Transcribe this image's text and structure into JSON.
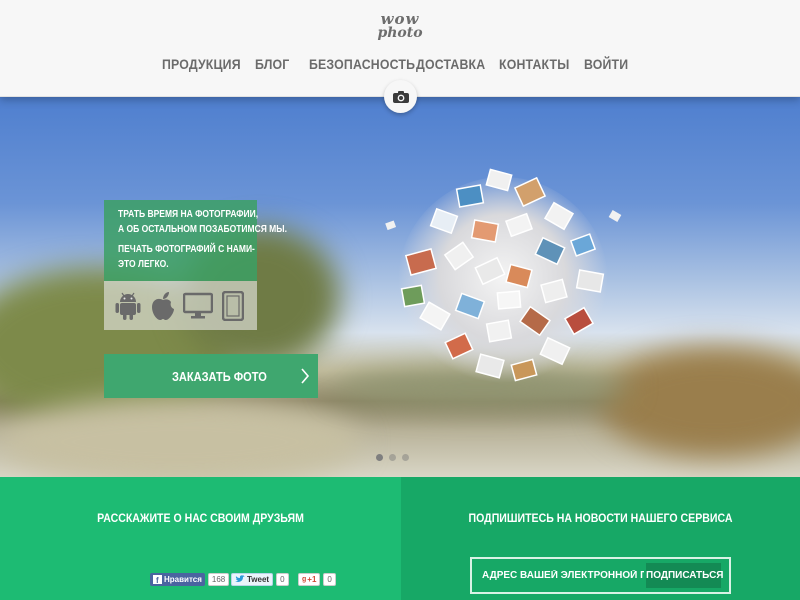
{
  "header": {
    "logo_line1": "wow",
    "logo_line2": "photo",
    "nav": [
      {
        "label": "ПРОДУКЦИЯ"
      },
      {
        "label": "БЛОГ"
      },
      {
        "label": "БЕЗОПАСНОСТЬ"
      },
      {
        "label": "ДОСТАВКА"
      },
      {
        "label": "КОНТАКТЫ"
      },
      {
        "label": "ВОЙТИ"
      }
    ],
    "badge_icon": "camera-icon"
  },
  "hero": {
    "promo_lines": [
      "ТРАТЬ ВРЕМЯ НА ФОТОГРАФИИ,",
      "А ОБ ОСТАЛЬНОМ ПОЗАБОТИМСЯ МЫ.",
      "ПЕЧАТЬ ФОТОГРАФИЙ С НАМИ-",
      "ЭТО ЛЕГКО."
    ],
    "platform_icons": [
      "android-icon",
      "apple-icon",
      "desktop-icon",
      "tablet-icon"
    ],
    "order_button": "ЗАКАЗАТЬ ФОТО",
    "slider_dots": 3,
    "active_dot": 1
  },
  "share": {
    "title": "РАССКАЖИТЕ О НАС СВОИМ ДРУЗЬЯМ",
    "facebook_label": "Нравится",
    "facebook_count": "168",
    "twitter_label": "Tweet",
    "twitter_count": "0",
    "gplus_label": "+1",
    "gplus_count": "0"
  },
  "subscribe": {
    "title": "ПОДПИШИТЕСЬ НА НОВОСТИ НАШЕГО СЕРВИСА",
    "email_placeholder": "АДРЕС ВАШЕЙ ЭЛЕКТРОННОЙ ПОЧТЫ",
    "button": "ПОДПИСАТЬСЯ"
  },
  "colors": {
    "brand_green": "#1dbb73",
    "brand_green_dark": "#17a866",
    "button_green": "#3fa76f",
    "nav_text": "#6b6b6b"
  }
}
